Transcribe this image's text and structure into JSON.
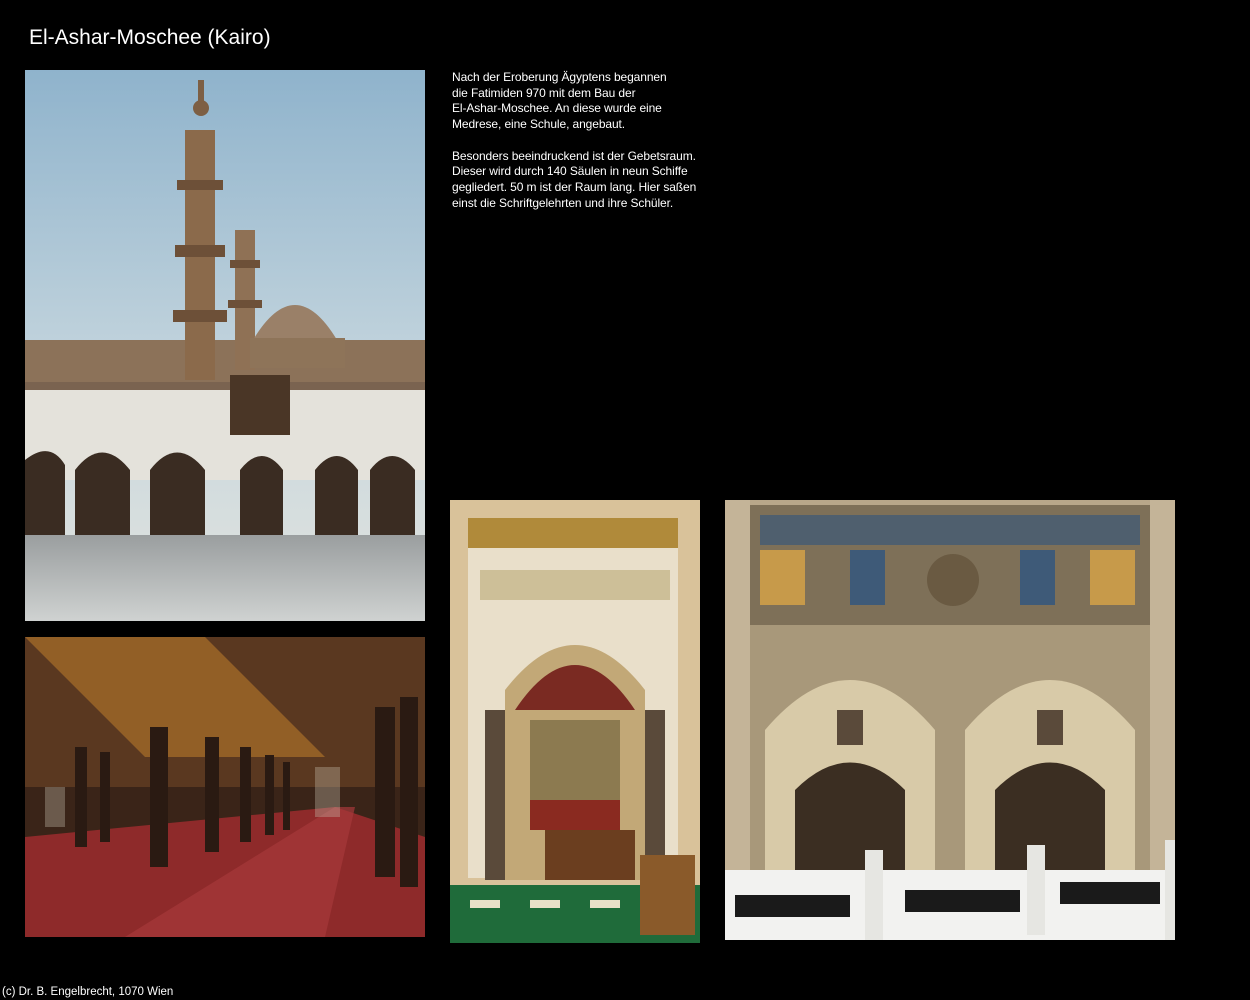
{
  "page": {
    "title": "El-Ashar-Moschee (Kairo)",
    "footer": "(c) Dr. B. Engelbrecht, 1070 Wien"
  },
  "description": {
    "paragraphs": [
      [
        "Nach der Eroberung Ägyptens begannen",
        "die Fatimiden 970 mit dem Bau der",
        "El-Ashar-Moschee. An diese wurde eine",
        "Medrese, eine Schule, angebaut."
      ],
      [
        "Besonders beeindruckend ist der Gebetsraum.",
        "Dieser wird durch 140 Säulen in neun Schiffe",
        "gegliedert. 50 m ist der Raum lang. Hier saßen",
        "einst die Schriftgelehrten und ihre Schüler."
      ]
    ]
  },
  "photos": [
    {
      "subject": "courtyard-minarets-dome"
    },
    {
      "subject": "prayer-hall-columns"
    },
    {
      "subject": "mihrab-niche"
    },
    {
      "subject": "ornate-gateway"
    }
  ],
  "colors": {
    "background": "#000000",
    "text": "#ffffff"
  }
}
